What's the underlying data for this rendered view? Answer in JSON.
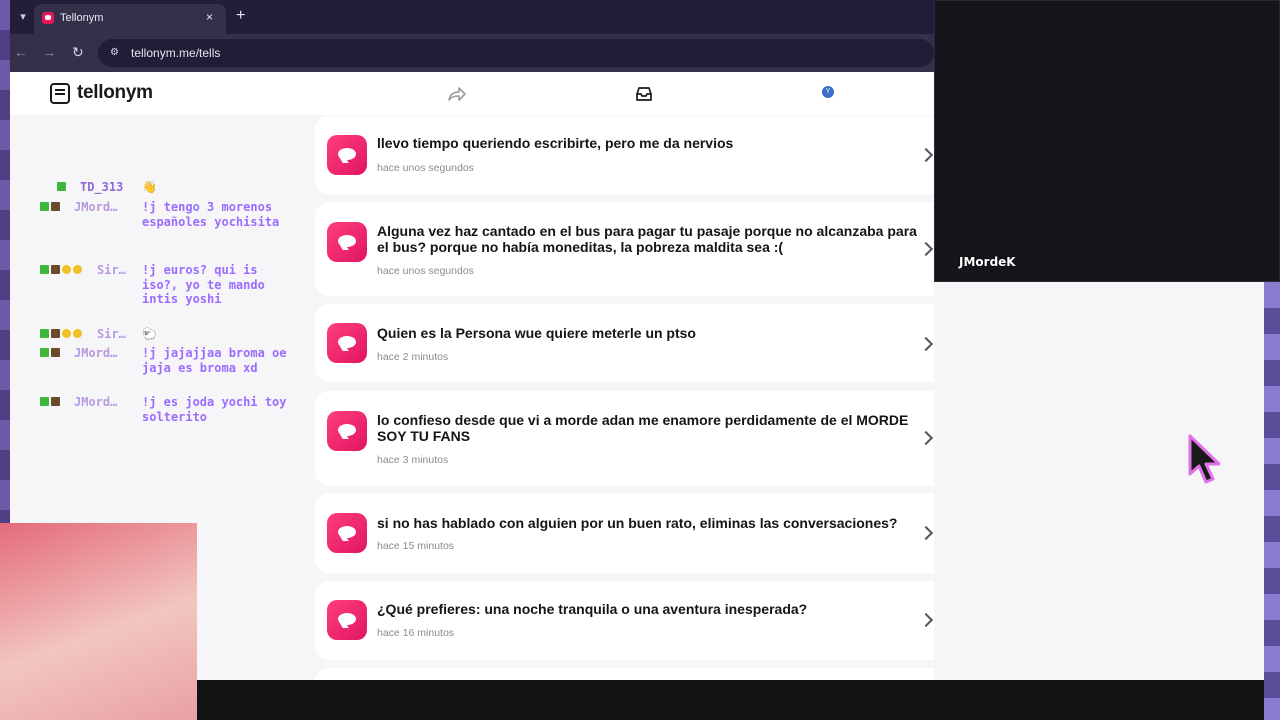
{
  "browser": {
    "tab_title": "Tellonym",
    "tab_close": "×",
    "new_tab": "+",
    "menu_icon": "▾",
    "url": "tellonym.me/tells"
  },
  "app": {
    "logo": "tellonym",
    "profile_initial": "Y",
    "accent_color": "#e9165a"
  },
  "tells": [
    {
      "text": "llevo tiempo queriendo escribirte, pero me da nervios",
      "time": "hace unos segundos"
    },
    {
      "text": "Alguna vez haz cantado en el bus para pagar tu pasaje porque no alcanzaba para el bus? porque no había moneditas, la pobreza maldita sea :(",
      "time": "hace unos segundos"
    },
    {
      "text": "Quien es la Persona wue quiere meterle un ptso",
      "time": "hace 2 minutos"
    },
    {
      "text": "lo confieso desde que vi a morde adan me enamore perdidamente de el MORDE SOY TU FANS",
      "time": "hace 3 minutos"
    },
    {
      "text": "si no has hablado con alguien por un buen rato, eliminas las conversaciones?",
      "time": "hace 15 minutos"
    },
    {
      "text": "¿Qué prefieres: una noche tranquila o una aventura inesperada?",
      "time": "hace 16 minutos"
    }
  ],
  "chat": [
    {
      "user": "TD_313",
      "message": "",
      "emote": "👋"
    },
    {
      "user": "JMord…",
      "message": "!j tengo 3 morenos españoles yochisita"
    },
    {
      "user": "Sir…",
      "message": "!j euros? qui is iso?, yo te mando intis yoshi"
    },
    {
      "user": "Sir…",
      "message": "",
      "emote": "🐑"
    },
    {
      "user": "JMord…",
      "message": "!j jajajjaa broma oe jaja es broma xd"
    },
    {
      "user": "JMord…",
      "message": "!j es joda yochi toy solterito"
    }
  ],
  "webcam": {
    "label": "JMordeK"
  }
}
